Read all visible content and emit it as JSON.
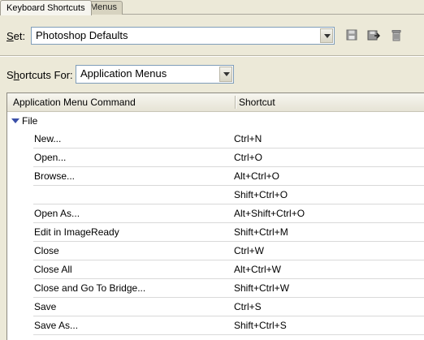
{
  "tabs": [
    {
      "label": "Keyboard Shortcuts",
      "active": true
    },
    {
      "label": "Menus",
      "active": false
    }
  ],
  "set": {
    "label_accel": "S",
    "label_rest": "et:",
    "value": "Photoshop Defaults",
    "icons": [
      "save-icon",
      "save-as-icon",
      "delete-icon"
    ]
  },
  "shortcuts_for": {
    "label_pre": "S",
    "label_accel": "h",
    "label_rest": "ortcuts For:",
    "value": "Application Menus"
  },
  "table": {
    "columns": [
      "Application Menu Command",
      "Shortcut"
    ],
    "group": "File",
    "rows": [
      {
        "command": "New...",
        "shortcut": "Ctrl+N"
      },
      {
        "command": "Open...",
        "shortcut": "Ctrl+O"
      },
      {
        "command": "Browse...",
        "shortcut": "Alt+Ctrl+O"
      },
      {
        "command": "",
        "shortcut": "Shift+Ctrl+O"
      },
      {
        "command": "Open As...",
        "shortcut": "Alt+Shift+Ctrl+O"
      },
      {
        "command": "Edit in ImageReady",
        "shortcut": "Shift+Ctrl+M"
      },
      {
        "command": "Close",
        "shortcut": "Ctrl+W"
      },
      {
        "command": "Close All",
        "shortcut": "Alt+Ctrl+W"
      },
      {
        "command": "Close and Go To Bridge...",
        "shortcut": "Shift+Ctrl+W"
      },
      {
        "command": "Save",
        "shortcut": "Ctrl+S"
      },
      {
        "command": "Save As...",
        "shortcut": "Shift+Ctrl+S"
      }
    ]
  }
}
